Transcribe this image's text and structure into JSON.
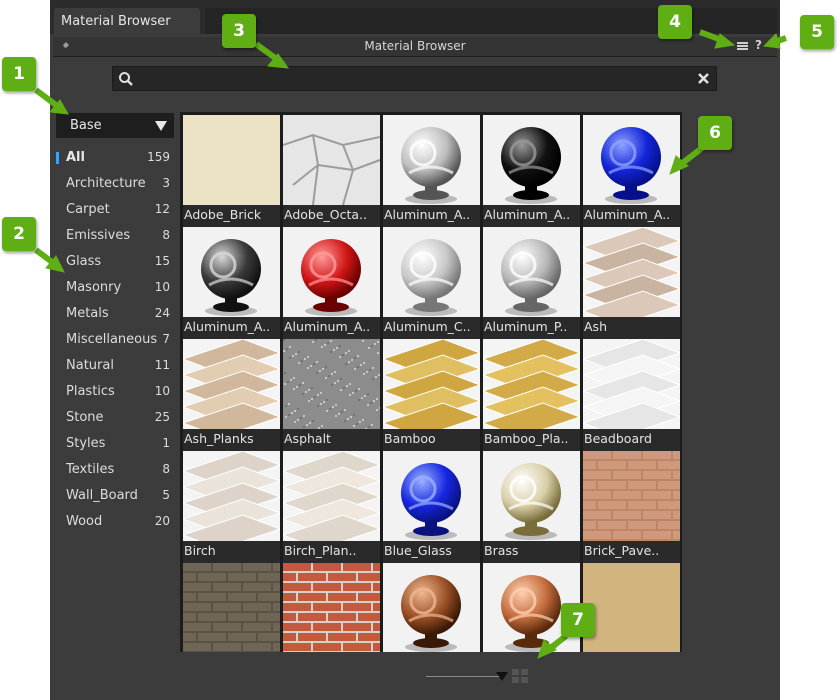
{
  "tab": {
    "label": "Material Browser"
  },
  "panel": {
    "title": "Material Browser"
  },
  "search": {
    "value": "",
    "placeholder": ""
  },
  "library": {
    "selected": "Base"
  },
  "categories": [
    {
      "name": "All",
      "count": "159"
    },
    {
      "name": "Architecture",
      "count": "3"
    },
    {
      "name": "Carpet",
      "count": "12"
    },
    {
      "name": "Emissives",
      "count": "8"
    },
    {
      "name": "Glass",
      "count": "15"
    },
    {
      "name": "Masonry",
      "count": "10"
    },
    {
      "name": "Metals",
      "count": "24"
    },
    {
      "name": "Miscellaneous",
      "count": "7"
    },
    {
      "name": "Natural",
      "count": "11"
    },
    {
      "name": "Plastics",
      "count": "10"
    },
    {
      "name": "Stone",
      "count": "25"
    },
    {
      "name": "Styles",
      "count": "1"
    },
    {
      "name": "Textiles",
      "count": "8"
    },
    {
      "name": "Wall_Board",
      "count": "5"
    },
    {
      "name": "Wood",
      "count": "20"
    }
  ],
  "materials": [
    {
      "label": "Adobe_Brick"
    },
    {
      "label": "Adobe_Octa.."
    },
    {
      "label": "Aluminum_A.."
    },
    {
      "label": "Aluminum_A.."
    },
    {
      "label": "Aluminum_A.."
    },
    {
      "label": "Aluminum_A.."
    },
    {
      "label": "Aluminum_A.."
    },
    {
      "label": "Aluminum_C.."
    },
    {
      "label": "Aluminum_P.."
    },
    {
      "label": "Ash"
    },
    {
      "label": "Ash_Planks"
    },
    {
      "label": "Asphalt"
    },
    {
      "label": "Bamboo"
    },
    {
      "label": "Bamboo_Pla.."
    },
    {
      "label": "Beadboard"
    },
    {
      "label": "Birch"
    },
    {
      "label": "Birch_Plan.."
    },
    {
      "label": "Blue_Glass"
    },
    {
      "label": "Brass"
    },
    {
      "label": "Brick_Pave.."
    },
    {
      "label": ""
    },
    {
      "label": ""
    },
    {
      "label": ""
    },
    {
      "label": ""
    },
    {
      "label": ""
    }
  ],
  "callouts": [
    "1",
    "2",
    "3",
    "4",
    "5",
    "6",
    "7"
  ],
  "icons": {
    "pin": "pin-icon",
    "menu": "hamburger-menu-icon",
    "help": "?",
    "search": "search-icon",
    "clear": "clear-icon",
    "grid_view": "grid-view-icon"
  },
  "colors": {
    "accent": "#2fa7ff",
    "callout": "#5fae14",
    "panel": "#3c3c3c"
  }
}
